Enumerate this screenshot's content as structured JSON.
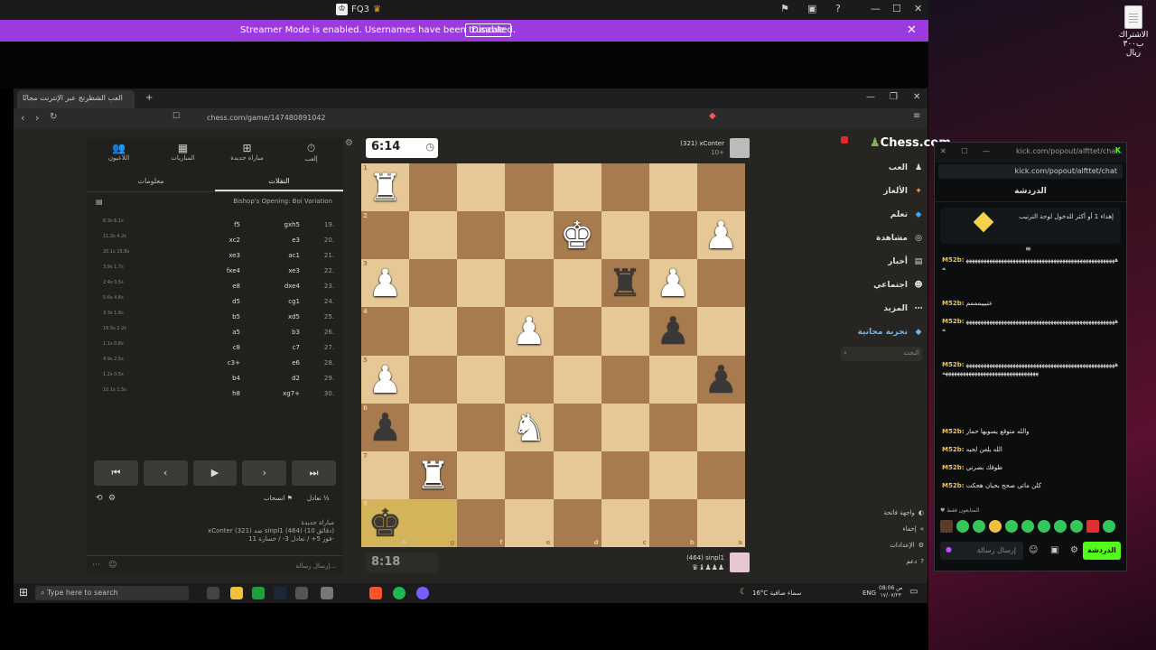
{
  "app_title": "FQ3",
  "streamer_bar": {
    "message": "Streamer Mode is enabled. Usernames have been truncated.",
    "disable_label": "Disable"
  },
  "desktop_icon": {
    "label": "الاشتراك ب٣٠٠ ريال"
  },
  "browser": {
    "tab_title": "العب الشطرنج عبر الإنترنت مجانًا",
    "url": "chess.com/game/147480891042"
  },
  "left_panel": {
    "nav": [
      {
        "label": "إلعب"
      },
      {
        "label": "مباراة جديدة"
      },
      {
        "label": "المباريات"
      },
      {
        "label": "اللاعبون"
      }
    ],
    "subtabs": {
      "moves": "النقلات",
      "info": "معلومات"
    },
    "opening": "Bishop's Opening: Boi Variation",
    "moves": [
      {
        "n": "19.",
        "w": "gxh5",
        "b": "f5"
      },
      {
        "n": "20.",
        "w": "e3",
        "b": "xc2"
      },
      {
        "n": "21.",
        "w": "ac1",
        "b": "xe3"
      },
      {
        "n": "22.",
        "w": "xe3",
        "b": "fxe4"
      },
      {
        "n": "23.",
        "w": "dxe4",
        "b": "e8"
      },
      {
        "n": "24.",
        "w": "cg1",
        "b": "d5"
      },
      {
        "n": "25.",
        "w": "xd5",
        "b": "b5"
      },
      {
        "n": "26.",
        "w": "b3",
        "b": "a5"
      },
      {
        "n": "27.",
        "w": "c7",
        "b": "c8"
      },
      {
        "n": "28.",
        "w": "e6",
        "b": "c3+"
      },
      {
        "n": "29.",
        "w": "d2",
        "b": "b4"
      },
      {
        "n": "30.",
        "w": "xg7+",
        "b": "h8"
      }
    ],
    "move_times": [
      "6.3s 6.1s",
      "11.2s 4.2s",
      "20.1s 15.8s",
      "3.9s 1.7s",
      "2.4s 0.5s",
      "5.6s 4.8s",
      "3.3s 1.8s",
      "19.5s 2.2s",
      "1.1s 0.8s",
      "4.9s 2.5s",
      "1.2s 0.5s",
      "10.1s 1.5s"
    ],
    "controls": [
      "⏮",
      "‹",
      "▶",
      "›",
      "⏭"
    ],
    "draw_label": "تعادل",
    "resign_label": "انسحاب",
    "game_info": [
      "مباراة جديدة",
      "xConter (321) ضد sinpl1 (464) (10 دقائق)",
      "فوز 5+ / تعادل 3- / خسارة 11-"
    ],
    "chat_placeholder": "إرسال رسالة..."
  },
  "board": {
    "timer_top": "6:14",
    "timer_bottom": "8:18",
    "player_top": "(321) xConter",
    "player_top_sub": "10+",
    "player_bottom": "(464) sinpl1",
    "ranks": [
      "1",
      "2",
      "3",
      "4",
      "5",
      "6",
      "7",
      "8"
    ],
    "files": [
      "h",
      "g",
      "f",
      "e",
      "d",
      "c",
      "b",
      "a"
    ],
    "pieces": [
      {
        "r": 0,
        "c": 0,
        "p": "♜",
        "side": "w"
      },
      {
        "r": 1,
        "c": 4,
        "p": "♚",
        "side": "w"
      },
      {
        "r": 1,
        "c": 7,
        "p": "♟",
        "side": "w"
      },
      {
        "r": 2,
        "c": 0,
        "p": "♟",
        "side": "w"
      },
      {
        "r": 2,
        "c": 5,
        "p": "♜",
        "side": "b"
      },
      {
        "r": 2,
        "c": 6,
        "p": "♟",
        "side": "w"
      },
      {
        "r": 3,
        "c": 3,
        "p": "♟",
        "side": "w"
      },
      {
        "r": 3,
        "c": 6,
        "p": "♟",
        "side": "b"
      },
      {
        "r": 4,
        "c": 0,
        "p": "♟",
        "side": "w"
      },
      {
        "r": 4,
        "c": 7,
        "p": "♟",
        "side": "b"
      },
      {
        "r": 5,
        "c": 0,
        "p": "♟",
        "side": "b"
      },
      {
        "r": 5,
        "c": 3,
        "p": "♞",
        "side": "w"
      },
      {
        "r": 6,
        "c": 1,
        "p": "♜",
        "side": "w"
      },
      {
        "r": 7,
        "c": 0,
        "p": "♚",
        "side": "b"
      }
    ]
  },
  "right_nav": {
    "logo": "Chess.com",
    "items": [
      "العب",
      "الألغاز",
      "تعلم",
      "مشاهدة",
      "أخبار",
      "اجتماعي",
      "المزيد",
      "تجربة مجانية"
    ],
    "search_placeholder": "البحث",
    "bottom": [
      "واجهة فاتحة",
      "إخفاء",
      "الإعدادات",
      "دعم"
    ]
  },
  "taskbar": {
    "search_placeholder": "Type here to search",
    "weather": "16°C  سماء صافية",
    "lang": "ENG",
    "time": "08:06 ص",
    "date": "١٧/٠٧/٢٣"
  },
  "chat": {
    "window_url": "kick.com/popout/alfttet/cha...",
    "address": "kick.com/popout/alfttet/chat",
    "title": "الدردشة",
    "pinned": "إهداء 1 أو أكثر للدخول لوحة الترتيب",
    "messages": [
      {
        "user": "M52b:",
        "text": "ههههههههههههههههههههههههههههههههههههههههههههههههههههه"
      },
      {
        "user": "M52b:",
        "text": "عتيييمممم"
      },
      {
        "user": "M52b:",
        "text": "ههههههههههههههههههههههههههههههههههههههههههههههههههههه"
      },
      {
        "user": "M52b:",
        "text": "ههههههههههههههههههههههههههههههههههههههههههههههههههههههههههههههههههههههههههههههههههههه"
      },
      {
        "user": "M52b:",
        "text": "والله متوقع يسويها حمار"
      },
      {
        "user": "M52b:",
        "text": "الله يلعن لحيه"
      },
      {
        "user": "M52b:",
        "text": "ظوقك بصرتي"
      },
      {
        "user": "M52b:",
        "text": "كلن ماتي صحح بحيان هجكت"
      }
    ],
    "mods_label": "المتابعون فقط",
    "input_placeholder": "إرسال رسالة",
    "send_label": "الدردشة"
  }
}
